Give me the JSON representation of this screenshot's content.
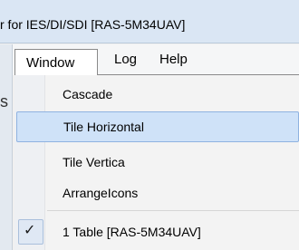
{
  "window": {
    "title": "r for IES/DI/SDI [RAS-5M34UAV]"
  },
  "menubar": {
    "items": [
      "Window",
      "Log",
      "Help"
    ]
  },
  "dropdown": {
    "items": [
      "Cascade",
      "Tile Horizontal",
      "Tile Vertica",
      "ArrangeIcons",
      "1 Table [RAS-5M34UAV]"
    ],
    "highlighted": "Tile Horizontal",
    "checked": "1 Table [RAS-5M34UAV]"
  },
  "icons": {
    "check": "checkmark-icon"
  }
}
